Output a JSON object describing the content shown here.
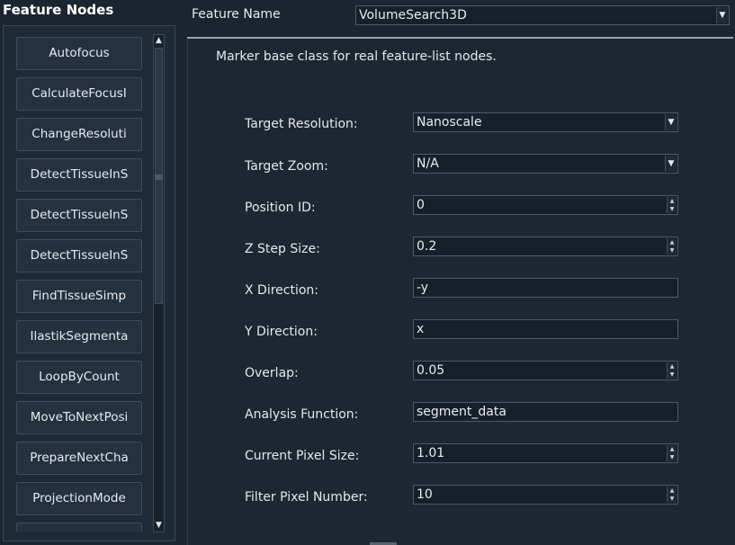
{
  "left_panel": {
    "title": "Feature Nodes",
    "nodes": [
      "Autofocus",
      "CalculateFocusI",
      "ChangeResoluti",
      "DetectTissueInS",
      "DetectTissueInS",
      "DetectTissueInS",
      "FindTissueSimp",
      "IlastikSegmenta",
      "LoopByCount",
      "MoveToNextPosi",
      "PrepareNextCha",
      "ProjectionMode",
      ""
    ]
  },
  "header": {
    "feature_name_label": "Feature Name",
    "feature_name_value": "VolumeSearch3D"
  },
  "description": "Marker base class for real feature-list nodes.",
  "fields": {
    "target_resolution": {
      "label": "Target Resolution:",
      "value": "Nanoscale"
    },
    "target_zoom": {
      "label": "Target Zoom:",
      "value": "N/A"
    },
    "position_id": {
      "label": "Position ID:",
      "value": "0"
    },
    "z_step_size": {
      "label": "Z Step Size:",
      "value": "0.2"
    },
    "x_direction": {
      "label": "X Direction:",
      "value": "-y"
    },
    "y_direction": {
      "label": "Y Direction:",
      "value": "x"
    },
    "overlap": {
      "label": "Overlap:",
      "value": "0.05"
    },
    "analysis_function": {
      "label": "Analysis Function:",
      "value": "segment_data"
    },
    "current_pixel_size": {
      "label": "Current Pixel Size:",
      "value": "1.01"
    },
    "filter_pixel_number": {
      "label": "Filter Pixel Number:",
      "value": "10"
    }
  },
  "icons": {
    "dropdown": "chevron-down-icon",
    "spin_up": "arrow-up-icon",
    "spin_down": "arrow-down-icon",
    "scroll_up": "arrow-up-icon",
    "scroll_down": "arrow-down-icon"
  },
  "colors": {
    "background": "#1b2530",
    "panel": "#1e2a35",
    "field": "#16202a",
    "border": "#4a5a68",
    "text": "#e4e8ec"
  }
}
